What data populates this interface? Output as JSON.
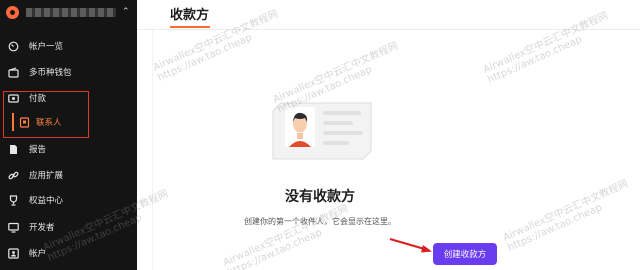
{
  "sidebar": {
    "org_caret": "⌃",
    "items": [
      {
        "label": "帐户一览",
        "icon": "dashboard-icon"
      },
      {
        "label": "多币种钱包",
        "icon": "wallet-icon"
      },
      {
        "label": "付款",
        "icon": "payment-icon"
      },
      {
        "label": "联系人",
        "icon": "contact-icon"
      },
      {
        "label": "报告",
        "icon": "report-icon"
      },
      {
        "label": "应用扩展",
        "icon": "link-icon"
      },
      {
        "label": "权益中心",
        "icon": "trophy-icon"
      },
      {
        "label": "开发者",
        "icon": "monitor-icon"
      },
      {
        "label": "帐户",
        "icon": "account-icon"
      }
    ]
  },
  "header": {
    "title": "收款方"
  },
  "empty_state": {
    "title": "没有收款方",
    "description": "创建你的第一个收件人，它会显示在这里。",
    "button_label": "创建收款方"
  },
  "watermark": {
    "line1": "Airwallex空中云汇中文教程网",
    "line2": "https://aw.tao.cheap"
  },
  "colors": {
    "accent": "#ff6a2f",
    "button": "#6a3cf0",
    "sidebar_bg": "#141414",
    "highlight_border": "#d93a2b"
  }
}
